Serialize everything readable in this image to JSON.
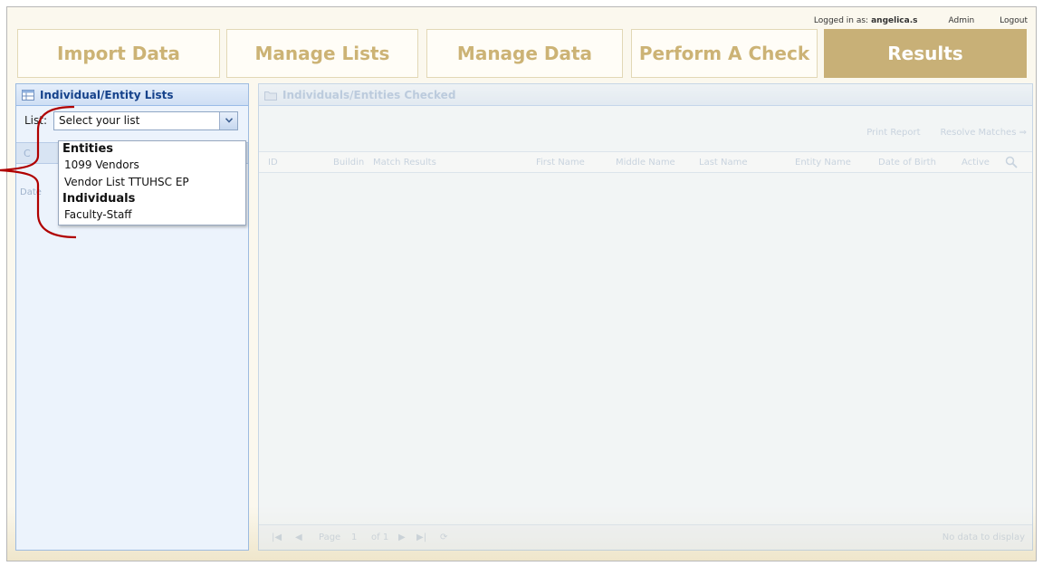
{
  "header": {
    "logged_in_label": "Logged in as:",
    "username": "angelica.s",
    "admin_link": "Admin",
    "logout_link": "Logout"
  },
  "nav_tabs": [
    {
      "label": "Import Data",
      "active": false
    },
    {
      "label": "Manage Lists",
      "active": false
    },
    {
      "label": "Manage Data",
      "active": false
    },
    {
      "label": "Perform A Check",
      "active": false
    },
    {
      "label": "Results",
      "active": true
    }
  ],
  "left_panel": {
    "title": "Individual/Entity Lists",
    "list_label": "List:",
    "combo_value": "Select your list",
    "sub_header_text": "C",
    "sub_column_text": "Date",
    "dropdown": [
      {
        "group": "Entities",
        "items": [
          "1099 Vendors",
          "Vendor List TTUHSC EP"
        ]
      },
      {
        "group": "Individuals",
        "items": [
          "Faculty-Staff"
        ]
      }
    ]
  },
  "right_panel": {
    "title": "Individuals/Entities Checked",
    "print_report": "Print Report",
    "resolve_matches": "Resolve Matches",
    "columns": [
      "ID",
      "Buildin",
      "Match Results",
      "First Name",
      "Middle Name",
      "Last Name",
      "Entity Name",
      "Date of Birth",
      "Active"
    ],
    "pager": {
      "page_label": "Page",
      "page_value": "1",
      "of_label": "of 1",
      "empty_text": "No data to display"
    }
  },
  "colors": {
    "tab_text": "#ccb375",
    "tab_active_bg": "#c8b077",
    "annotation_brace": "#b00000"
  }
}
